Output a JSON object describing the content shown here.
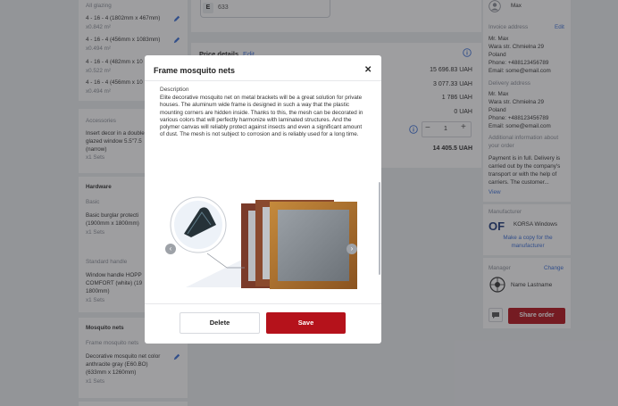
{
  "left": {
    "glazing_header": "All glazing",
    "glazing_items": [
      {
        "label": "4 - 16 - 4 (1802mm x 467mm)",
        "qty": "x0.842 m²"
      },
      {
        "label": "4 - 16 - 4 (456mm x 1083mm)",
        "qty": "x0.494 m²"
      },
      {
        "label": "4 - 16 - 4 (482mm x 10",
        "qty": "x0.522 m²"
      },
      {
        "label": "4 - 16 - 4 (456mm x 10",
        "qty": "x0.494 m²"
      }
    ],
    "accessories_label": "Accessories",
    "accessory_lines": [
      "Insert decor in a double",
      "glazed window 5.5\"7.5",
      "(narrow)"
    ],
    "accessory_qty": "x1 Sets",
    "hardware_title": "Hardware",
    "basic_label": "Basic",
    "basic_lines": [
      "Basic burglar protecti",
      "(1900mm x 1800mm)"
    ],
    "basic_qty": "x1 Sets",
    "standard_label": "Standard handle",
    "handle_lines": [
      "Window handle HOPP",
      "COMFORT (white) (19",
      "1800mm)"
    ],
    "handle_qty": "x1 Sets",
    "mosquito_title": "Mosquito nets",
    "mosquito_sub": "Frame mosquito nets",
    "mosquito_lines": [
      "Decorative mosquito net color",
      "anthracite gray (E60.BO)",
      "(633mm x 1260mm)"
    ],
    "mosquito_qty": "x1 Sets"
  },
  "center": {
    "e_tag": "E",
    "e_value": "633",
    "price_title": "Price details",
    "price_edit": "Edit",
    "prices": [
      "15 696.83 UAH",
      "3 077.33 UAH",
      "1 786 UAH",
      "0 UAH"
    ],
    "qty_value": "1",
    "total": "14 405.5 UAH"
  },
  "right": {
    "user_name": "Max",
    "invoice_label": "Invoice address",
    "invoice_edit": "Edit",
    "invoice_lines": [
      "Mr. Max",
      "Wara str. Chmielna 29",
      "Poland",
      "Phone: +488123456789",
      "Email: some@email.com"
    ],
    "delivery_label": "Delivery address",
    "delivery_lines": [
      "Mr. Max",
      "Wara str. Chmielna 29",
      "Poland",
      "Phone: +488123456789",
      "Email: some@email.com"
    ],
    "additional_label": "Additional information about your order",
    "additional_lines": [
      "Payment is in full. Delivery is",
      "carried out by the company's",
      "transport or with the help of",
      "carriers. The customer..."
    ],
    "view_link": "View",
    "manufacturer_label": "Manufacturer",
    "manufacturer_name": "KORSA Windows",
    "copy_link": "Make a copy for the manufacturer",
    "manager_label": "Manager",
    "manager_change": "Change",
    "manager_name": "Name Lastname",
    "share_button": "Share order"
  },
  "modal": {
    "title": "Frame mosquito nets",
    "description_label": "Description",
    "description_text": "Elite decorative mosquito net on metal brackets will be a great solution for private houses. The aluminum wide frame is designed in such a way that the plastic mounting corners are hidden inside. Thanks to this, the mesh can be decorated in various colors that will perfectly harmonize with laminated structures. And the polymer canvas will reliably protect against insects and even a significant amount of dust. The mesh is not subject to corrosion and is reliably used for a long time.",
    "delete_label": "Delete",
    "save_label": "Save"
  },
  "colors": {
    "accent_red": "#b5121b",
    "link_blue": "#3b6fd8"
  }
}
